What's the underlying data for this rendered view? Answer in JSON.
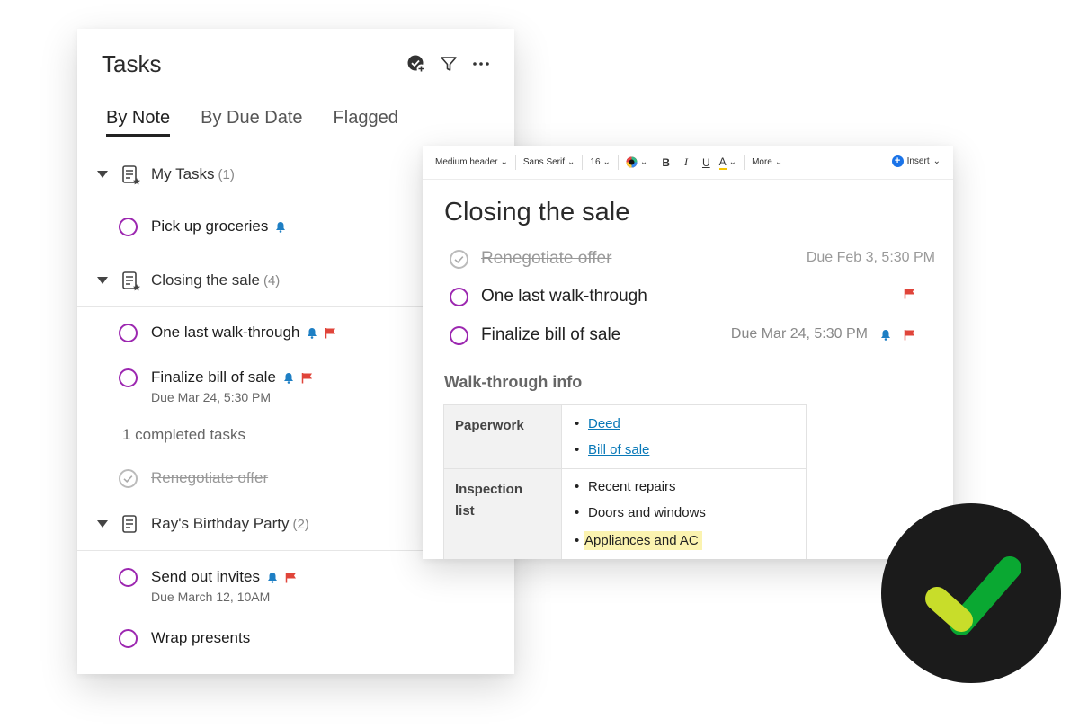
{
  "tasks_panel": {
    "title": "Tasks",
    "tabs": [
      "By Note",
      "By Due Date",
      "Flagged"
    ],
    "groups": [
      {
        "name": "My Tasks",
        "count": "(1)",
        "tasks": [
          {
            "name": "Pick up groceries"
          }
        ]
      },
      {
        "name": "Closing the sale",
        "count": "(4)",
        "tasks": [
          {
            "name": "One last walk-through"
          },
          {
            "name": "Finalize bill of sale",
            "due": "Due Mar 24, 5:30 PM"
          }
        ],
        "completed_label": "1 completed tasks",
        "completed": [
          {
            "name": "Renegotiate offer"
          }
        ]
      },
      {
        "name": "Ray's Birthday Party",
        "count": "(2)",
        "tasks": [
          {
            "name": "Send out invites",
            "due": "Due March 12, 10AM"
          },
          {
            "name": "Wrap presents"
          }
        ]
      }
    ]
  },
  "note_panel": {
    "toolbar": {
      "style": "Medium header",
      "font": "Sans Serif",
      "size": "16",
      "bold": "B",
      "italic": "I",
      "underline": "U",
      "highlight": "A",
      "more": "More",
      "insert": "Insert"
    },
    "title": "Closing the sale",
    "tasks": [
      {
        "name": "Renegotiate offer",
        "due": "Due Feb 3, 5:30 PM",
        "done": true
      },
      {
        "name": "One last walk-through"
      },
      {
        "name": "Finalize bill of sale",
        "due": "Due Mar 24, 5:30 PM"
      }
    ],
    "section_title": "Walk-through info",
    "table": {
      "row1_key": "Paperwork",
      "row1_links": [
        "Deed",
        "Bill of sale"
      ],
      "row2_key_line1": "Inspection",
      "row2_key_line2": "list",
      "row2_items": [
        "Recent repairs",
        "Doors and windows",
        "Appliances and AC"
      ]
    }
  },
  "colors": {
    "accent_purple": "#9c27b0",
    "flag_red": "#e0443a",
    "bell_blue": "#1e7fc4",
    "link_blue": "#0a79b8",
    "highlight_yellow": "#fbf3b0",
    "check_green": "#0aa832",
    "check_lime": "#c8dd2a"
  },
  "icons": [
    "task-add-icon",
    "filter-icon",
    "more-icon",
    "note-icon",
    "bell-icon",
    "flag-icon",
    "check-icon",
    "chevron-down-icon",
    "color-icon",
    "plus-icon"
  ]
}
